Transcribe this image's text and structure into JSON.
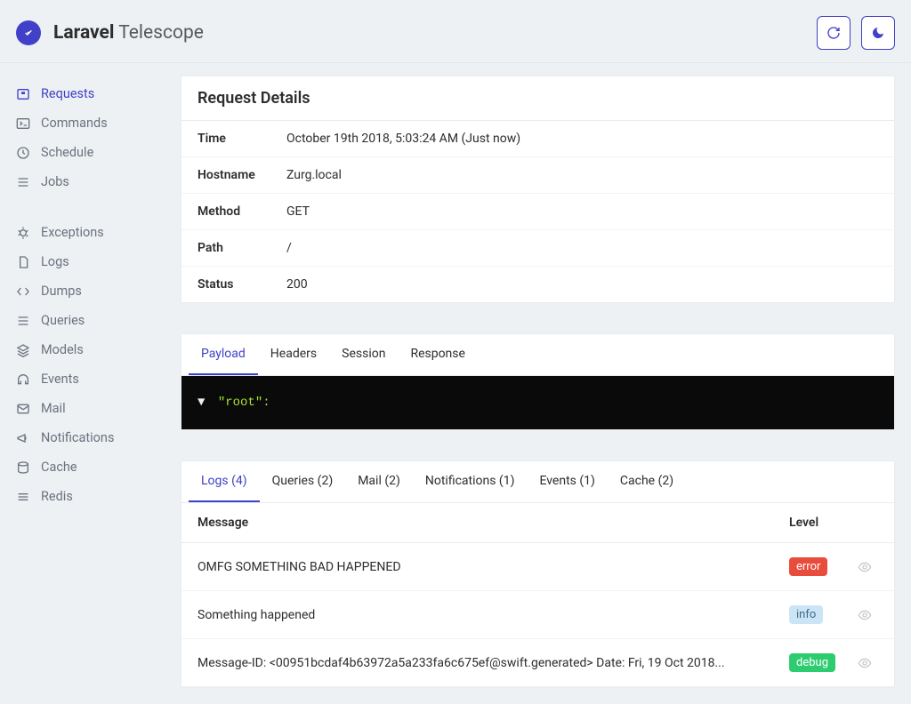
{
  "brand": {
    "bold": "Laravel",
    "light": "Telescope"
  },
  "header_buttons": {
    "refresh": "refresh",
    "theme": "theme-toggle"
  },
  "sidebar": {
    "group1": [
      {
        "label": "Requests",
        "icon": "request-icon",
        "active": true
      },
      {
        "label": "Commands",
        "icon": "terminal-icon",
        "active": false
      },
      {
        "label": "Schedule",
        "icon": "clock-icon",
        "active": false
      },
      {
        "label": "Jobs",
        "icon": "list-icon",
        "active": false
      }
    ],
    "group2": [
      {
        "label": "Exceptions",
        "icon": "bug-icon"
      },
      {
        "label": "Logs",
        "icon": "file-icon"
      },
      {
        "label": "Dumps",
        "icon": "code-icon"
      },
      {
        "label": "Queries",
        "icon": "list-icon"
      },
      {
        "label": "Models",
        "icon": "layers-icon"
      },
      {
        "label": "Events",
        "icon": "headphones-icon"
      },
      {
        "label": "Mail",
        "icon": "mail-icon"
      },
      {
        "label": "Notifications",
        "icon": "megaphone-icon"
      },
      {
        "label": "Cache",
        "icon": "database-icon"
      },
      {
        "label": "Redis",
        "icon": "stack-icon"
      }
    ]
  },
  "details": {
    "title": "Request Details",
    "rows": [
      {
        "label": "Time",
        "value": "October 19th 2018, 5:03:24 AM (Just now)"
      },
      {
        "label": "Hostname",
        "value": "Zurg.local"
      },
      {
        "label": "Method",
        "value": "GET"
      },
      {
        "label": "Path",
        "value": "/"
      },
      {
        "label": "Status",
        "value": "200"
      }
    ]
  },
  "content_tabs": [
    {
      "label": "Payload",
      "active": true
    },
    {
      "label": "Headers",
      "active": false
    },
    {
      "label": "Session",
      "active": false
    },
    {
      "label": "Response",
      "active": false
    }
  ],
  "payload": {
    "root_key": "\"root\":"
  },
  "related_tabs": [
    {
      "label": "Logs (4)",
      "active": true
    },
    {
      "label": "Queries (2)",
      "active": false
    },
    {
      "label": "Mail (2)",
      "active": false
    },
    {
      "label": "Notifications (1)",
      "active": false
    },
    {
      "label": "Events (1)",
      "active": false
    },
    {
      "label": "Cache (2)",
      "active": false
    }
  ],
  "logs_table": {
    "headers": {
      "message": "Message",
      "level": "Level"
    },
    "rows": [
      {
        "message": "OMFG SOMETHING BAD HAPPENED",
        "level": "error",
        "level_class": "error"
      },
      {
        "message": "Something happened",
        "level": "info",
        "level_class": "info"
      },
      {
        "message": "Message-ID: <00951bcdaf4b63972a5a233fa6c675ef@swift.generated> Date: Fri, 19 Oct 2018...",
        "level": "debug",
        "level_class": "debug"
      }
    ]
  }
}
